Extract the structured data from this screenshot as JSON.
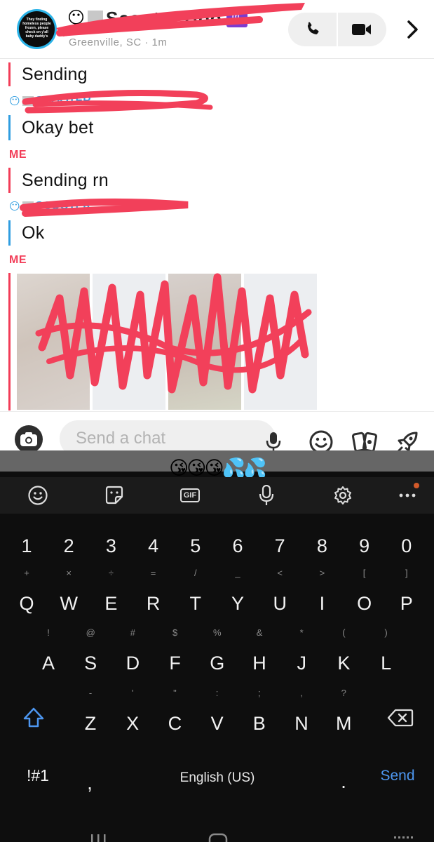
{
  "header": {
    "avatar_text": "They finding homeless people frozen, please check on y'all baby daddy's",
    "name_emoji": "😶",
    "name": "Scooter Boo",
    "zodiac_glyph": "♏",
    "location": "Greenville, SC · 1m"
  },
  "chat": {
    "messages": [
      {
        "sender": "me",
        "text": "Sending"
      },
      {
        "sender": "them",
        "label": "SCOOTER",
        "text": "Okay bet"
      },
      {
        "sender": "me",
        "label": "ME",
        "text": "Sending rn"
      },
      {
        "sender": "them",
        "label": "SCOOTER",
        "text": "Ok"
      }
    ],
    "media_label": "ME",
    "media_tile_count": 4
  },
  "input": {
    "placeholder": "Send a chat"
  },
  "keyboard": {
    "emoji_suggestions": "😘😘😘💦💦",
    "number_row": [
      "1",
      "2",
      "3",
      "4",
      "5",
      "6",
      "7",
      "8",
      "9",
      "0"
    ],
    "row1": [
      {
        "key": "Q",
        "sub": "+"
      },
      {
        "key": "W",
        "sub": "×"
      },
      {
        "key": "E",
        "sub": "÷"
      },
      {
        "key": "R",
        "sub": "="
      },
      {
        "key": "T",
        "sub": "/"
      },
      {
        "key": "Y",
        "sub": "_"
      },
      {
        "key": "U",
        "sub": "<"
      },
      {
        "key": "I",
        "sub": ">"
      },
      {
        "key": "O",
        "sub": "["
      },
      {
        "key": "P",
        "sub": "]"
      }
    ],
    "row2": [
      {
        "key": "A",
        "sub": "!"
      },
      {
        "key": "S",
        "sub": "@"
      },
      {
        "key": "D",
        "sub": "#"
      },
      {
        "key": "F",
        "sub": "$"
      },
      {
        "key": "G",
        "sub": "%"
      },
      {
        "key": "H",
        "sub": "&"
      },
      {
        "key": "J",
        "sub": "*"
      },
      {
        "key": "K",
        "sub": "("
      },
      {
        "key": "L",
        "sub": ")"
      }
    ],
    "row3": [
      {
        "key": "Z",
        "sub": "-"
      },
      {
        "key": "X",
        "sub": "'"
      },
      {
        "key": "C",
        "sub": "\""
      },
      {
        "key": "V",
        "sub": ":"
      },
      {
        "key": "B",
        "sub": ";"
      },
      {
        "key": "N",
        "sub": ","
      },
      {
        "key": "M",
        "sub": "?"
      }
    ],
    "symbols_label": "!#1",
    "comma_label": ",",
    "language_label": "English (US)",
    "period_label": ".",
    "send_label": "Send"
  },
  "colors": {
    "me_accent": "#f23c57",
    "them_accent": "#2f9de0",
    "send_blue": "#4d96ef",
    "keyboard_bg": "#0e0e0e"
  },
  "icons": [
    "phone-icon",
    "video-icon",
    "chevron-right-icon",
    "camera-icon",
    "microphone-icon",
    "smiley-icon",
    "stickers-icon",
    "rocket-icon",
    "gif-icon",
    "settings-icon",
    "more-icon",
    "shift-icon",
    "backspace-icon"
  ]
}
